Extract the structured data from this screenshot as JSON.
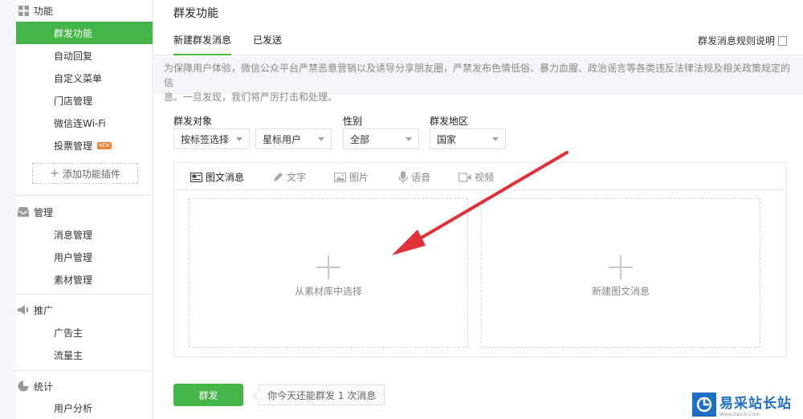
{
  "sidebar": {
    "groups": [
      {
        "title": "功能",
        "icon": "grid-icon"
      },
      {
        "title": "管理",
        "icon": "inbox-icon"
      },
      {
        "title": "推广",
        "icon": "megaphone-icon"
      },
      {
        "title": "统计",
        "icon": "pie-icon"
      }
    ],
    "function_items": [
      "群发功能",
      "自动回复",
      "自定义菜单",
      "门店管理",
      "微信连Wi-Fi",
      "投票管理"
    ],
    "new_badge": "NEW",
    "add_plugin": "添加功能插件",
    "manage_items": [
      "消息管理",
      "用户管理",
      "素材管理"
    ],
    "promo_items": [
      "广告主",
      "流量主"
    ],
    "stats_items": [
      "用户分析"
    ]
  },
  "main": {
    "title": "群发功能",
    "tabs": [
      {
        "label": "新建群发消息",
        "active": true
      },
      {
        "label": "已发送",
        "active": false
      }
    ],
    "rule_link": "群发消息规则说明",
    "notice_line1": "为保障用户体验，微信公众平台严禁恶意营销以及诱导分享朋友圈，严禁发布色情低俗、暴力血腥、政治谣言等各类违反法律法规及相关政策规定的信",
    "notice_line2": "息。一旦发现，我们将严厉打击和处理。",
    "filters": {
      "target_label": "群发对象",
      "target_value": "按标签选择",
      "tag_value": "星标用户",
      "gender_label": "性别",
      "gender_value": "全部",
      "region_label": "群发地区",
      "region_value": "国家"
    },
    "editor_tabs": [
      "图文消息",
      "文字",
      "图片",
      "语音",
      "视频"
    ],
    "box_left": "从素材库中选择",
    "box_right": "新建图文消息",
    "send_button": "群发",
    "send_tip": "你今天还能群发 1 次消息"
  },
  "watermark": {
    "text": "易采站长站",
    "subtext": "Www.Easck.Com"
  },
  "colors": {
    "accent": "#44b549",
    "arrow": "#e0303a",
    "notice_bg": "#f4f5f9",
    "watermark": "#1d6fc4"
  }
}
